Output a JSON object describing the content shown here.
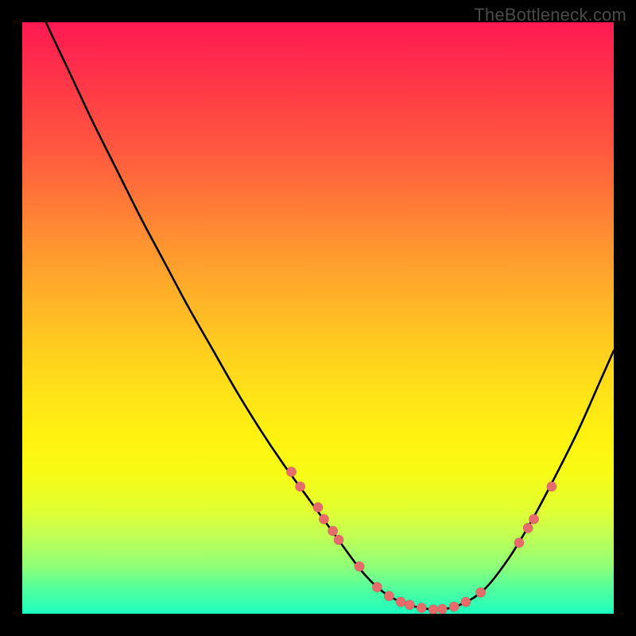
{
  "watermark": "TheBottleneck.com",
  "chart_data": {
    "type": "line",
    "title": "",
    "xlabel": "",
    "ylabel": "",
    "xlim": [
      0,
      100
    ],
    "ylim": [
      0,
      100
    ],
    "x": [
      0,
      4,
      8,
      12,
      16,
      20,
      24,
      28,
      32,
      36,
      40,
      44,
      48,
      52,
      56,
      58,
      60,
      62,
      64,
      66,
      70,
      74,
      78,
      82,
      86,
      90,
      94,
      98,
      100
    ],
    "values": [
      109,
      100,
      91.5,
      83,
      75,
      67,
      59.5,
      52,
      45,
      38,
      31.5,
      25.5,
      20,
      14.5,
      9,
      6.5,
      4.5,
      3,
      2,
      1.3,
      0.7,
      1.5,
      4,
      9,
      15.5,
      23,
      31,
      40,
      44.5
    ],
    "dot_series": {
      "name": "markers",
      "points": [
        {
          "x": 45.5,
          "y": 24
        },
        {
          "x": 47,
          "y": 21.5
        },
        {
          "x": 50,
          "y": 18
        },
        {
          "x": 51,
          "y": 16
        },
        {
          "x": 52.5,
          "y": 14
        },
        {
          "x": 53.5,
          "y": 12.5
        },
        {
          "x": 57,
          "y": 8
        },
        {
          "x": 60,
          "y": 4.5
        },
        {
          "x": 62,
          "y": 3
        },
        {
          "x": 64,
          "y": 2
        },
        {
          "x": 65.5,
          "y": 1.5
        },
        {
          "x": 67.5,
          "y": 1
        },
        {
          "x": 69.5,
          "y": 0.7
        },
        {
          "x": 71,
          "y": 0.8
        },
        {
          "x": 73,
          "y": 1.2
        },
        {
          "x": 75,
          "y": 2
        },
        {
          "x": 77.5,
          "y": 3.6
        },
        {
          "x": 84,
          "y": 12
        },
        {
          "x": 85.5,
          "y": 14.5
        },
        {
          "x": 86.5,
          "y": 16
        },
        {
          "x": 89.5,
          "y": 21.5
        }
      ]
    },
    "background": "vertical gradient red-yellow-green representing bottleneck severity"
  }
}
